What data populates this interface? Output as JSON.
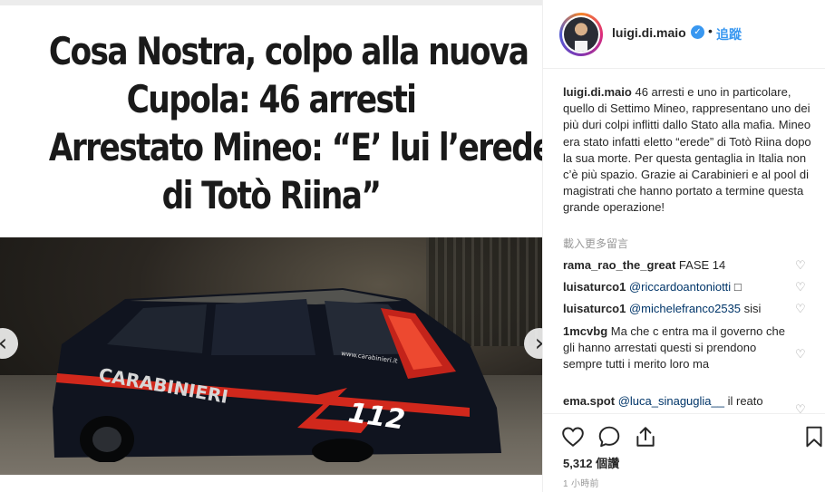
{
  "post": {
    "headline_lines": [
      "Cosa Nostra, colpo alla nuova",
      "Cupola: 46 arresti",
      "Arrestato Mineo: “E’ lui l’erede",
      "di Totò Riina”"
    ],
    "photo_texts": {
      "carabinieri": "CARABINIERI",
      "number": "112",
      "website": "www.carabinieri.it"
    }
  },
  "header": {
    "username": "luigi.di.maio",
    "separator": "•",
    "follow_label": "追蹤",
    "verified_glyph": "✓"
  },
  "caption": {
    "username": "luigi.di.maio",
    "text": "46 arresti e uno in particolare, quello di Settimo Mineo, rappresentano uno dei più duri colpi inflitti dallo Stato alla mafia. Mineo era stato infatti eletto “erede” di Totò Riina dopo la sua morte. Per questa gentaglia in Italia non c’è più spazio. Grazie ai Carabinieri e al pool di magistrati che hanno portato a termine questa grande operazione!"
  },
  "load_more_label": "載入更多留言",
  "comments": [
    {
      "user": "rama_rao_the_great",
      "mention": "",
      "text": "FASE 14"
    },
    {
      "user": "luisaturco1",
      "mention": "@riccardoantoniotti",
      "text": "□"
    },
    {
      "user": "luisaturco1",
      "mention": "@michelefranco2535",
      "text": "sisi"
    },
    {
      "user": "1mcvbg",
      "mention": "",
      "text": "Ma che c entra ma il governo che gli hanno arrestati questi si prendono sempre tutti i merito loro ma"
    },
    {
      "user": "ema.spot",
      "mention": "@luca_sinaguglia__",
      "text": "il reato"
    }
  ],
  "likes_label": "5,312 個讚",
  "time_label": "1 小時前",
  "nav": {
    "prev_glyph": "‹",
    "next_glyph": "›"
  },
  "icons": [
    "heart-icon",
    "comment-icon",
    "share-icon",
    "bookmark-icon",
    "verified-icon",
    "comment-like-heart-icon",
    "chevron-left-icon",
    "chevron-right-icon"
  ],
  "colors": {
    "link": "#3897f0",
    "mention": "#003569",
    "muted": "#999999",
    "text": "#262626",
    "border": "#efefef"
  }
}
